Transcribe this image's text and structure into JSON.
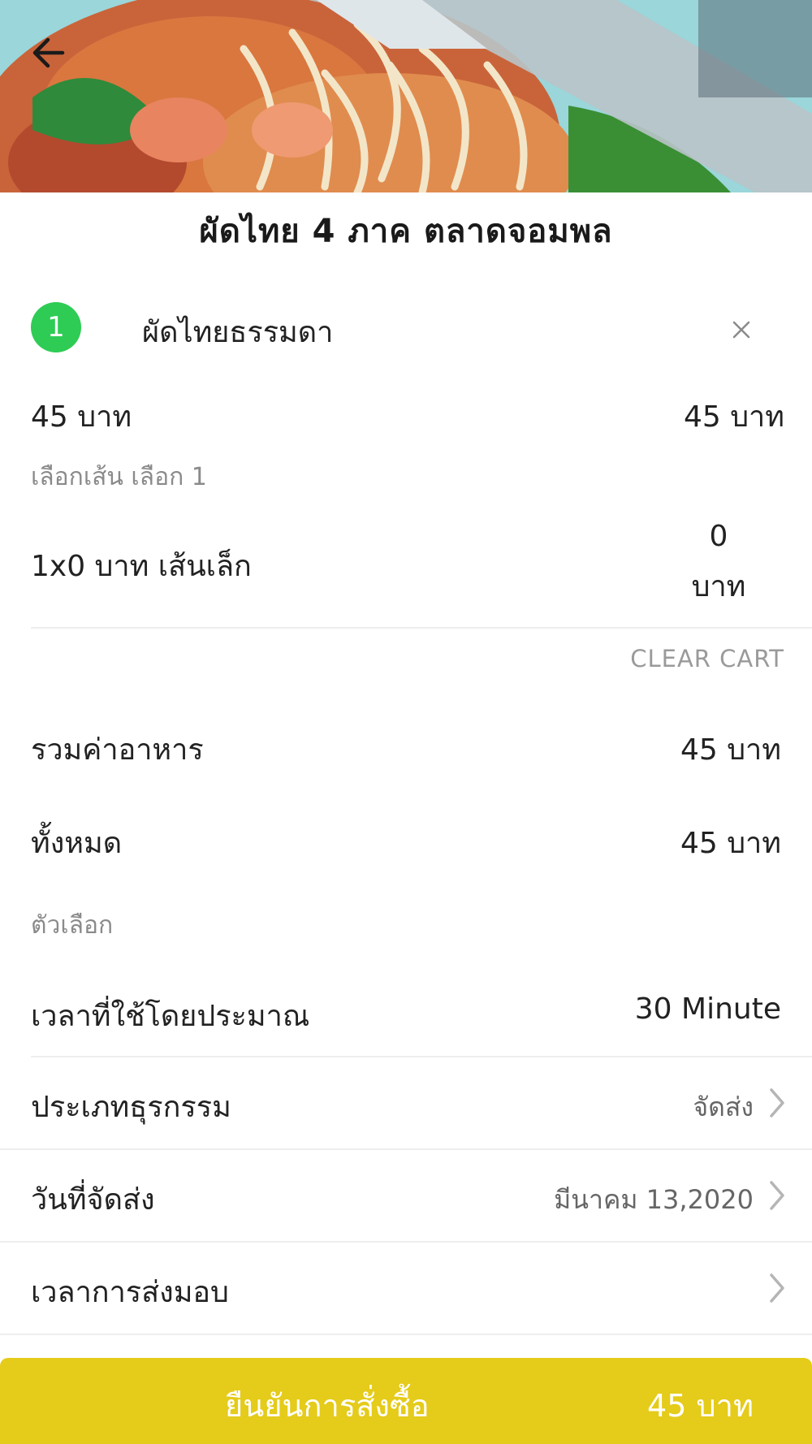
{
  "header": {
    "image_alt": "food photo",
    "back_icon": "arrow-left-icon"
  },
  "shop": {
    "title": "ผัดไทย 4 ภาค ตลาดจอมพล"
  },
  "cart_item": {
    "quantity": "1",
    "name": "ผัดไทยธรรมดา",
    "remove_icon": "close-icon",
    "unit_price": "45 บาท",
    "line_total": "45 บาท",
    "option_group_label": "เลือกเส้น เลือก 1",
    "option_detail": "1x0 บาท  เส้นเล็ก",
    "option_price_amount": "0",
    "option_price_unit": "บาท"
  },
  "clear_cart_label": "CLEAR CART",
  "summary": {
    "food_total_label": "รวมค่าอาหาร",
    "food_total_value": "45 บาท",
    "grand_total_label": "ทั้งหมด",
    "grand_total_value": "45 บาท"
  },
  "options": {
    "section_label": "ตัวเลือก",
    "est_time_label": "เวลาที่ใช้โดยประมาณ",
    "est_time_value": "30 Minute",
    "business_type_label": "ประเภทธุรกรรม",
    "business_type_value": "จัดส่ง",
    "delivery_date_label": "วันที่จัดส่ง",
    "delivery_date_value": "มีนาคม 13,2020",
    "delivery_time_label": "เวลาการส่งมอบ",
    "delivery_time_value": ""
  },
  "confirm": {
    "label": "ยืนยันการสั่งซื้อ",
    "total": "45 บาท"
  },
  "colors": {
    "accent_yellow": "#e5cb1a",
    "badge_green": "#2ecc55",
    "muted_text": "#8a8a8a"
  }
}
